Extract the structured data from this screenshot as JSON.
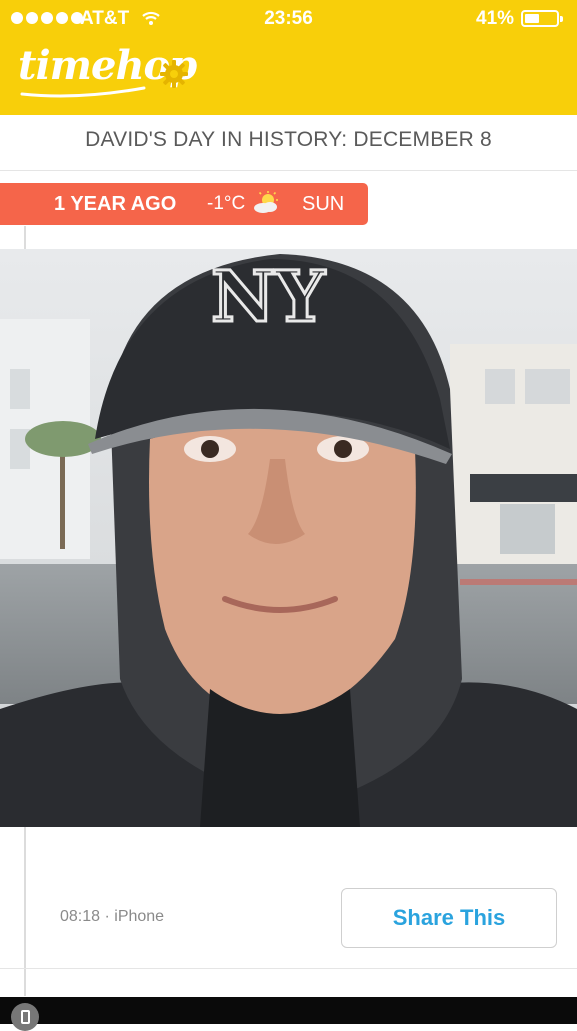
{
  "status_bar": {
    "carrier": "AT&T",
    "time": "23:56",
    "battery_percent": "41%",
    "battery_level": 0.41,
    "signal_icon": "signal-dots-icon",
    "wifi_icon": "wifi-icon"
  },
  "app": {
    "logo_text": "timehop",
    "settings_icon": "gear-icon"
  },
  "day_title": "DAVID'S DAY IN HISTORY: DECEMBER 8",
  "banner": {
    "years_ago": "1 YEAR AGO",
    "temperature": "-1°C",
    "weather_icon": "partly-cloudy-icon",
    "day_of_week": "SUN"
  },
  "post": {
    "source_icon": "phone-icon",
    "photo_alt": "Selfie of a person in a black cap and hood on a rainy street",
    "meta": "08:18 · iPhone",
    "share_label": "Share This"
  },
  "colors": {
    "header_yellow": "#f8cf0a",
    "banner_coral": "#f5654a",
    "share_blue": "#2aa3de"
  }
}
